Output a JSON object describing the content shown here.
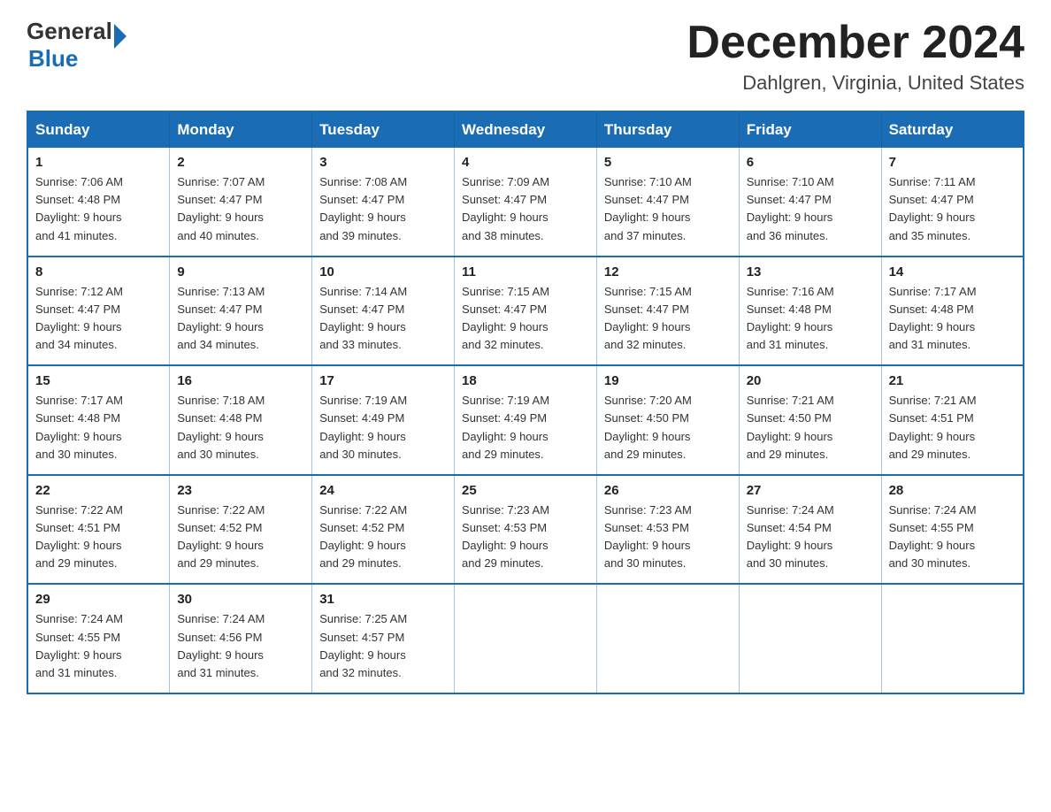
{
  "logo": {
    "general": "General",
    "blue": "Blue"
  },
  "header": {
    "month": "December 2024",
    "location": "Dahlgren, Virginia, United States"
  },
  "weekdays": [
    "Sunday",
    "Monday",
    "Tuesday",
    "Wednesday",
    "Thursday",
    "Friday",
    "Saturday"
  ],
  "weeks": [
    [
      {
        "day": "1",
        "sunrise": "7:06 AM",
        "sunset": "4:48 PM",
        "daylight": "9 hours and 41 minutes."
      },
      {
        "day": "2",
        "sunrise": "7:07 AM",
        "sunset": "4:47 PM",
        "daylight": "9 hours and 40 minutes."
      },
      {
        "day": "3",
        "sunrise": "7:08 AM",
        "sunset": "4:47 PM",
        "daylight": "9 hours and 39 minutes."
      },
      {
        "day": "4",
        "sunrise": "7:09 AM",
        "sunset": "4:47 PM",
        "daylight": "9 hours and 38 minutes."
      },
      {
        "day": "5",
        "sunrise": "7:10 AM",
        "sunset": "4:47 PM",
        "daylight": "9 hours and 37 minutes."
      },
      {
        "day": "6",
        "sunrise": "7:10 AM",
        "sunset": "4:47 PM",
        "daylight": "9 hours and 36 minutes."
      },
      {
        "day": "7",
        "sunrise": "7:11 AM",
        "sunset": "4:47 PM",
        "daylight": "9 hours and 35 minutes."
      }
    ],
    [
      {
        "day": "8",
        "sunrise": "7:12 AM",
        "sunset": "4:47 PM",
        "daylight": "9 hours and 34 minutes."
      },
      {
        "day": "9",
        "sunrise": "7:13 AM",
        "sunset": "4:47 PM",
        "daylight": "9 hours and 34 minutes."
      },
      {
        "day": "10",
        "sunrise": "7:14 AM",
        "sunset": "4:47 PM",
        "daylight": "9 hours and 33 minutes."
      },
      {
        "day": "11",
        "sunrise": "7:15 AM",
        "sunset": "4:47 PM",
        "daylight": "9 hours and 32 minutes."
      },
      {
        "day": "12",
        "sunrise": "7:15 AM",
        "sunset": "4:47 PM",
        "daylight": "9 hours and 32 minutes."
      },
      {
        "day": "13",
        "sunrise": "7:16 AM",
        "sunset": "4:48 PM",
        "daylight": "9 hours and 31 minutes."
      },
      {
        "day": "14",
        "sunrise": "7:17 AM",
        "sunset": "4:48 PM",
        "daylight": "9 hours and 31 minutes."
      }
    ],
    [
      {
        "day": "15",
        "sunrise": "7:17 AM",
        "sunset": "4:48 PM",
        "daylight": "9 hours and 30 minutes."
      },
      {
        "day": "16",
        "sunrise": "7:18 AM",
        "sunset": "4:48 PM",
        "daylight": "9 hours and 30 minutes."
      },
      {
        "day": "17",
        "sunrise": "7:19 AM",
        "sunset": "4:49 PM",
        "daylight": "9 hours and 30 minutes."
      },
      {
        "day": "18",
        "sunrise": "7:19 AM",
        "sunset": "4:49 PM",
        "daylight": "9 hours and 29 minutes."
      },
      {
        "day": "19",
        "sunrise": "7:20 AM",
        "sunset": "4:50 PM",
        "daylight": "9 hours and 29 minutes."
      },
      {
        "day": "20",
        "sunrise": "7:21 AM",
        "sunset": "4:50 PM",
        "daylight": "9 hours and 29 minutes."
      },
      {
        "day": "21",
        "sunrise": "7:21 AM",
        "sunset": "4:51 PM",
        "daylight": "9 hours and 29 minutes."
      }
    ],
    [
      {
        "day": "22",
        "sunrise": "7:22 AM",
        "sunset": "4:51 PM",
        "daylight": "9 hours and 29 minutes."
      },
      {
        "day": "23",
        "sunrise": "7:22 AM",
        "sunset": "4:52 PM",
        "daylight": "9 hours and 29 minutes."
      },
      {
        "day": "24",
        "sunrise": "7:22 AM",
        "sunset": "4:52 PM",
        "daylight": "9 hours and 29 minutes."
      },
      {
        "day": "25",
        "sunrise": "7:23 AM",
        "sunset": "4:53 PM",
        "daylight": "9 hours and 29 minutes."
      },
      {
        "day": "26",
        "sunrise": "7:23 AM",
        "sunset": "4:53 PM",
        "daylight": "9 hours and 30 minutes."
      },
      {
        "day": "27",
        "sunrise": "7:24 AM",
        "sunset": "4:54 PM",
        "daylight": "9 hours and 30 minutes."
      },
      {
        "day": "28",
        "sunrise": "7:24 AM",
        "sunset": "4:55 PM",
        "daylight": "9 hours and 30 minutes."
      }
    ],
    [
      {
        "day": "29",
        "sunrise": "7:24 AM",
        "sunset": "4:55 PM",
        "daylight": "9 hours and 31 minutes."
      },
      {
        "day": "30",
        "sunrise": "7:24 AM",
        "sunset": "4:56 PM",
        "daylight": "9 hours and 31 minutes."
      },
      {
        "day": "31",
        "sunrise": "7:25 AM",
        "sunset": "4:57 PM",
        "daylight": "9 hours and 32 minutes."
      },
      null,
      null,
      null,
      null
    ]
  ],
  "labels": {
    "sunrise": "Sunrise:",
    "sunset": "Sunset:",
    "daylight": "Daylight:"
  }
}
